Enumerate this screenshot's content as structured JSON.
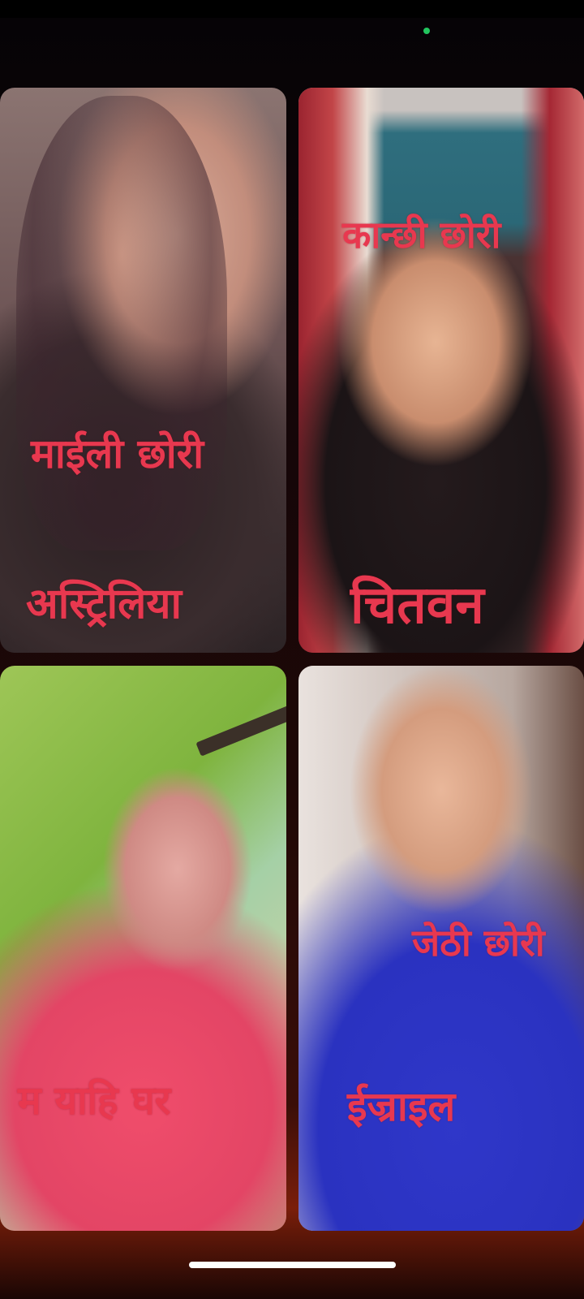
{
  "tiles": [
    {
      "id": "top-left",
      "captions": [
        "माईली छोरी",
        "अस्ट्रिलिया"
      ]
    },
    {
      "id": "top-right",
      "captions": [
        "कान्छी छोरी",
        "चितवन"
      ]
    },
    {
      "id": "bottom-left",
      "captions": [
        "म याहि घर"
      ]
    },
    {
      "id": "bottom-right",
      "captions": [
        "जेठी छोरी",
        "ईज्राइल"
      ]
    }
  ],
  "colors": {
    "caption": "#e8384f",
    "camera_indicator": "#22c55e",
    "home_indicator": "#ffffff"
  },
  "icons": [
    "camera-in-use-indicator-icon"
  ]
}
